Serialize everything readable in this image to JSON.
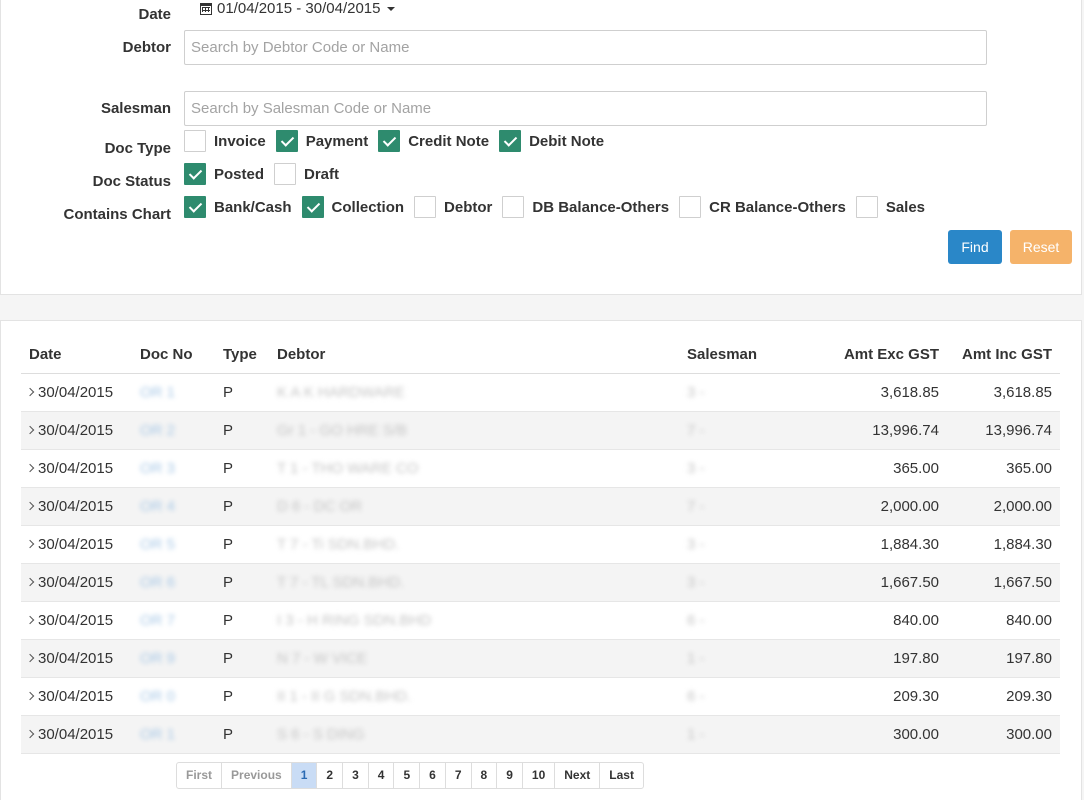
{
  "filters": {
    "date_label": "Date",
    "date_range": "01/04/2015 - 30/04/2015",
    "debtor_label": "Debtor",
    "debtor_placeholder": "Search by Debtor Code or Name",
    "salesman_label": "Salesman",
    "salesman_placeholder": "Search by Salesman Code or Name",
    "doc_type_label": "Doc Type",
    "doc_types": [
      {
        "label": "Invoice",
        "checked": false
      },
      {
        "label": "Payment",
        "checked": true
      },
      {
        "label": "Credit Note",
        "checked": true
      },
      {
        "label": "Debit Note",
        "checked": true
      }
    ],
    "doc_status_label": "Doc Status",
    "doc_statuses": [
      {
        "label": "Posted",
        "checked": true
      },
      {
        "label": "Draft",
        "checked": false
      }
    ],
    "contains_chart_label": "Contains Chart",
    "charts": [
      {
        "label": "Bank/Cash",
        "checked": true
      },
      {
        "label": "Collection",
        "checked": true
      },
      {
        "label": "Debtor",
        "checked": false
      },
      {
        "label": "DB Balance-Others",
        "checked": false
      },
      {
        "label": "CR Balance-Others",
        "checked": false
      },
      {
        "label": "Sales",
        "checked": false
      }
    ],
    "find_label": "Find",
    "reset_label": "Reset"
  },
  "table": {
    "headers": {
      "date": "Date",
      "doc_no": "Doc No",
      "type": "Type",
      "debtor": "Debtor",
      "salesman": "Salesman",
      "amt_exc": "Amt Exc GST",
      "amt_inc": "Amt Inc GST"
    },
    "rows": [
      {
        "date": "30/04/2015",
        "doc_no": "OR 1",
        "type": "P",
        "debtor": "K A K HARDWARE",
        "salesman": "3 -",
        "amt_exc": "3,618.85",
        "amt_inc": "3,618.85"
      },
      {
        "date": "30/04/2015",
        "doc_no": "OR 2",
        "type": "P",
        "debtor": "Gr 1 - GO HRE S/B",
        "salesman": "7 -",
        "amt_exc": "13,996.74",
        "amt_inc": "13,996.74"
      },
      {
        "date": "30/04/2015",
        "doc_no": "OR 3",
        "type": "P",
        "debtor": "T 1 - THO WARE CO",
        "salesman": "3 -",
        "amt_exc": "365.00",
        "amt_inc": "365.00"
      },
      {
        "date": "30/04/2015",
        "doc_no": "OR 4",
        "type": "P",
        "debtor": "D 6 - DC OR",
        "salesman": "7 -",
        "amt_exc": "2,000.00",
        "amt_inc": "2,000.00"
      },
      {
        "date": "30/04/2015",
        "doc_no": "OR 5",
        "type": "P",
        "debtor": "T 7 - Ti SDN.BHD.",
        "salesman": "3 -",
        "amt_exc": "1,884.30",
        "amt_inc": "1,884.30"
      },
      {
        "date": "30/04/2015",
        "doc_no": "OR 6",
        "type": "P",
        "debtor": "T 7 - TL SDN.BHD.",
        "salesman": "3 -",
        "amt_exc": "1,667.50",
        "amt_inc": "1,667.50"
      },
      {
        "date": "30/04/2015",
        "doc_no": "OR 7",
        "type": "P",
        "debtor": "I 3 - H RING SDN.BHD",
        "salesman": "6 -",
        "amt_exc": "840.00",
        "amt_inc": "840.00"
      },
      {
        "date": "30/04/2015",
        "doc_no": "OR 9",
        "type": "P",
        "debtor": "N 7 - W VICE",
        "salesman": "1 -",
        "amt_exc": "197.80",
        "amt_inc": "197.80"
      },
      {
        "date": "30/04/2015",
        "doc_no": "OR 0",
        "type": "P",
        "debtor": "II 1 - II G SDN.BHD.",
        "salesman": "6 -",
        "amt_exc": "209.30",
        "amt_inc": "209.30"
      },
      {
        "date": "30/04/2015",
        "doc_no": "OR 1",
        "type": "P",
        "debtor": "S 6 - S DING",
        "salesman": "1 -",
        "amt_exc": "300.00",
        "amt_inc": "300.00"
      }
    ]
  },
  "pagination": {
    "first": "First",
    "previous": "Previous",
    "pages": [
      "1",
      "2",
      "3",
      "4",
      "5",
      "6",
      "7",
      "8",
      "9",
      "10"
    ],
    "active_page": "1",
    "next": "Next",
    "last": "Last"
  },
  "colors": {
    "check": "#2e8b6e",
    "find": "#2a87c8",
    "reset": "#f5b36a",
    "active_page": "#c9dcf5"
  }
}
